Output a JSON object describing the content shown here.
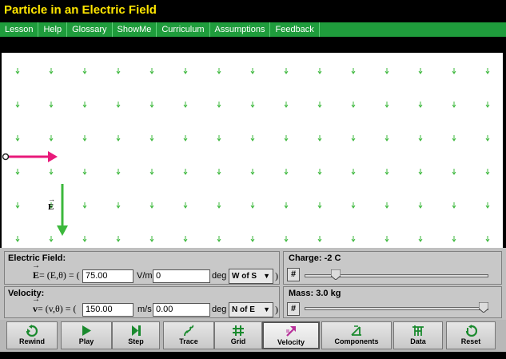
{
  "app": {
    "title": "Particle in an Electric Field"
  },
  "menu": {
    "items": [
      "Lesson",
      "Help",
      "Glossary",
      "ShowMe",
      "Curriculum",
      "Assumptions",
      "Feedback"
    ]
  },
  "stage": {
    "field_label": "E"
  },
  "electric_field": {
    "group_label": "Electric Field:",
    "vector_symbol": "E",
    "equation_text": " = (E,θ) = (",
    "magnitude_value": "75.00",
    "magnitude_unit": "V/m,",
    "angle_value": "0",
    "angle_unit": "deg",
    "direction_selected": "W of S",
    "close_paren": ")"
  },
  "velocity": {
    "group_label": "Velocity:",
    "vector_symbol": "v",
    "equation_text": " = (v,θ) = (",
    "magnitude_value": "150.00",
    "magnitude_unit": "m/s",
    "angle_value": "0.00",
    "angle_unit": "deg",
    "direction_selected": "N of E",
    "close_paren": ")"
  },
  "charge": {
    "label": "Charge: -2 C",
    "hash_label": "#",
    "level": 0.15
  },
  "mass": {
    "label": "Mass: 3.0 kg",
    "hash_label": "#",
    "level": 1.0
  },
  "toolbar": {
    "rewind": "Rewind",
    "play": "Play",
    "step": "Step",
    "trace": "Trace",
    "grid": "Grid",
    "velocity": "Velocity",
    "components": "Components",
    "data": "Data",
    "reset": "Reset"
  },
  "colors": {
    "field_arrow": "#3cb83c",
    "velocity_arrow": "#e8197a",
    "menu_bg": "#1f9c3c",
    "title": "#ffe600"
  }
}
